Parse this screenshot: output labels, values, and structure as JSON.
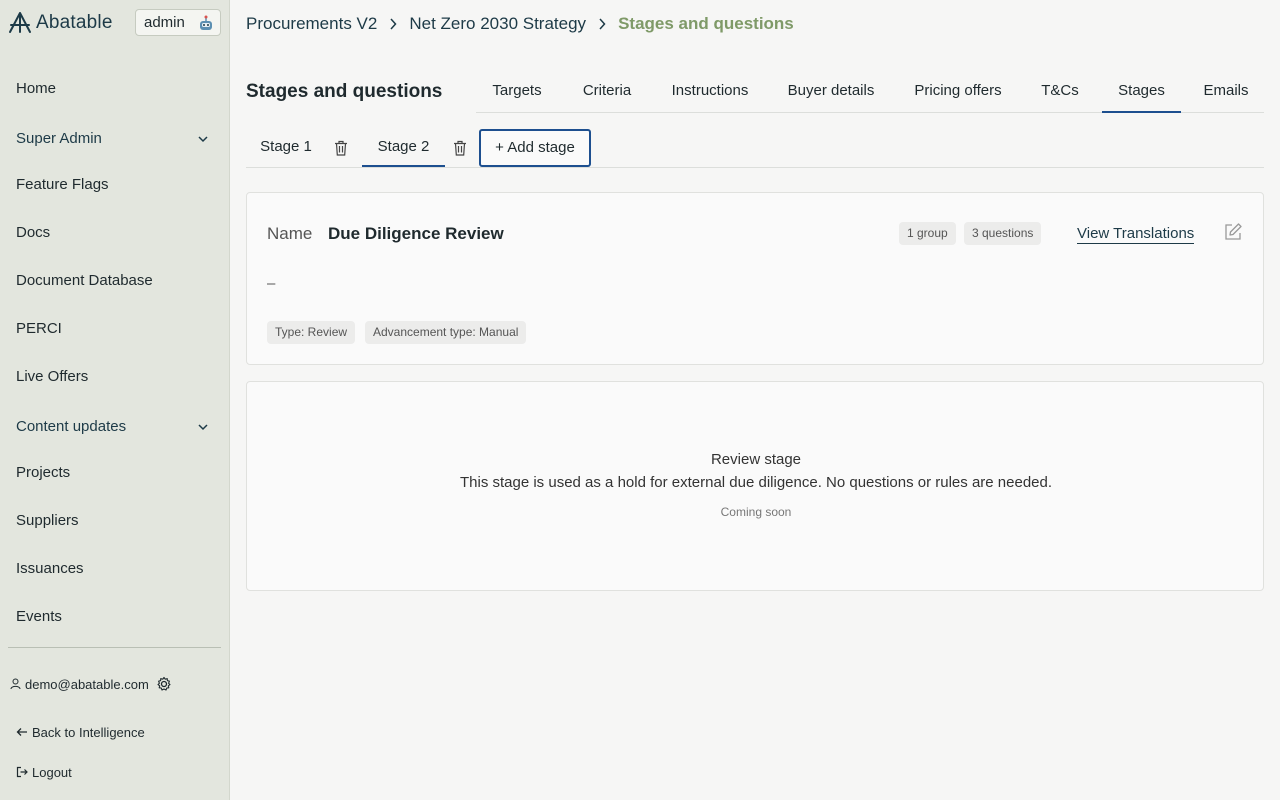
{
  "brand": {
    "name": "Abatable",
    "badge": "admin"
  },
  "sidebar": {
    "items": [
      {
        "label": "Home"
      },
      {
        "label": "Super Admin"
      },
      {
        "label": "Feature Flags"
      },
      {
        "label": "Docs"
      },
      {
        "label": "Document Database"
      },
      {
        "label": "PERCI"
      },
      {
        "label": "Live Offers"
      },
      {
        "label": "Content updates"
      },
      {
        "label": "Projects"
      },
      {
        "label": "Suppliers"
      },
      {
        "label": "Issuances"
      },
      {
        "label": "Events"
      }
    ],
    "user_email": "demo@abatable.com",
    "back_label": "Back to Intelligence",
    "logout_label": "Logout"
  },
  "breadcrumb": {
    "items": [
      "Procurements V2",
      "Net Zero 2030 Strategy",
      "Stages and questions"
    ]
  },
  "page": {
    "title": "Stages and questions"
  },
  "tabs": [
    {
      "label": "Targets"
    },
    {
      "label": "Criteria"
    },
    {
      "label": "Instructions"
    },
    {
      "label": "Buyer details"
    },
    {
      "label": "Pricing offers"
    },
    {
      "label": "T&Cs"
    },
    {
      "label": "Stages",
      "active": true
    },
    {
      "label": "Emails"
    }
  ],
  "stages": {
    "items": [
      {
        "label": "Stage 1"
      },
      {
        "label": "Stage 2",
        "active": true
      }
    ],
    "add_label": "+ Add stage"
  },
  "stage_card": {
    "name_label": "Name",
    "name": "Due Diligence Review",
    "groups_badge": "1 group",
    "questions_badge": "3 questions",
    "view_translations": "View Translations",
    "description": "–",
    "type_badge": "Type: Review",
    "advancement_badge": "Advancement type: Manual"
  },
  "review_card": {
    "title": "Review stage",
    "description": "This stage is used as a hold for external due diligence. No questions or rules are needed.",
    "note": "Coming soon"
  },
  "colors": {
    "accent": "#1d4f8f",
    "breadcrumb_current": "#7f9a68",
    "sidebar_bg": "#e3e6de"
  }
}
